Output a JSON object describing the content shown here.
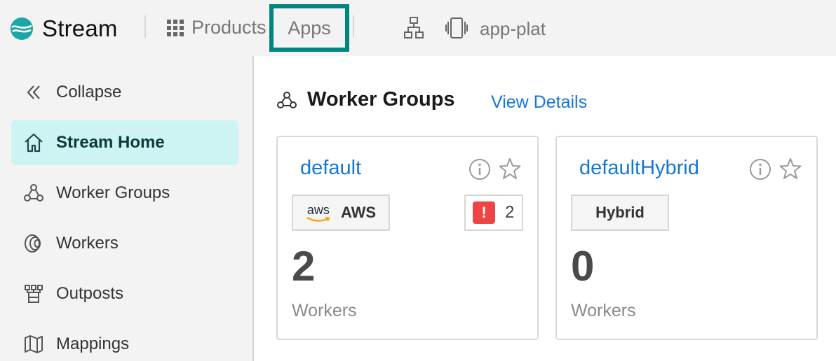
{
  "header": {
    "brand": "Stream",
    "products_label": "Products",
    "apps_label": "Apps",
    "workspace_label": "app-plat"
  },
  "sidebar": {
    "items": [
      {
        "label": "Collapse",
        "icon": "double-chevron-left-icon"
      },
      {
        "label": "Stream Home",
        "icon": "home-icon",
        "active": true
      },
      {
        "label": "Worker Groups",
        "icon": "worker-groups-icon"
      },
      {
        "label": "Workers",
        "icon": "workers-icon"
      },
      {
        "label": "Outposts",
        "icon": "outposts-icon"
      },
      {
        "label": "Mappings",
        "icon": "mappings-icon"
      }
    ]
  },
  "main": {
    "section_title": "Worker Groups",
    "view_details": "View Details",
    "cards": [
      {
        "name": "default",
        "platform_logo_text": "aws",
        "platform_label": "AWS",
        "alert_icon": "!",
        "alert_count": "2",
        "count": "2",
        "unit": "Workers"
      },
      {
        "name": "defaultHybrid",
        "platform_label": "Hybrid",
        "count": "0",
        "unit": "Workers"
      }
    ]
  },
  "colors": {
    "accent_teal": "#00857f",
    "link_blue": "#1677d6",
    "active_bg": "#cdf4f2",
    "alert_red": "#ef4444"
  }
}
